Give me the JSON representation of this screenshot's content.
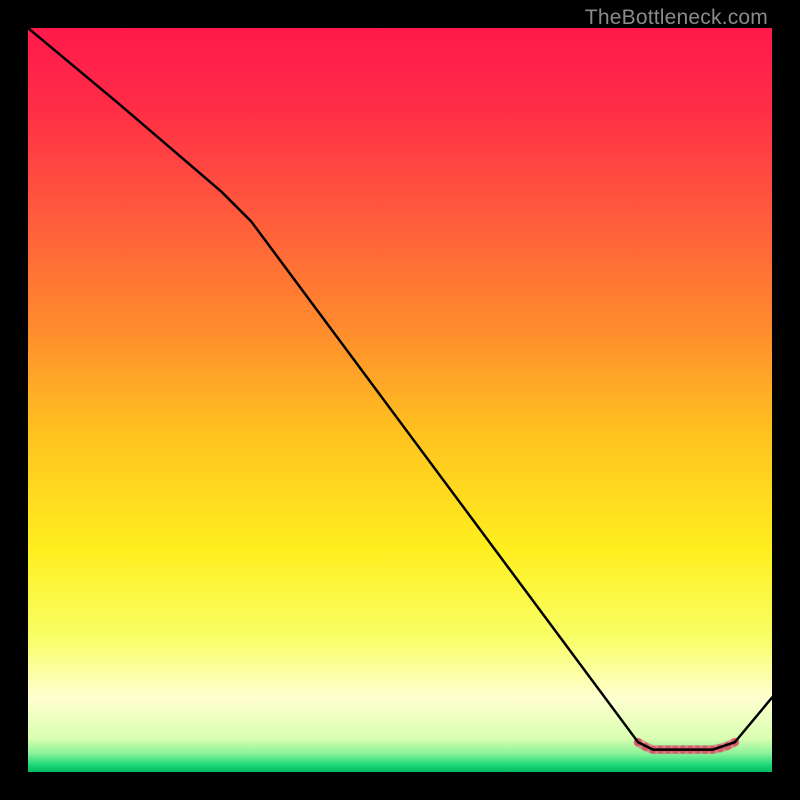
{
  "watermark": "TheBottleneck.com",
  "chart_data": {
    "type": "line",
    "title": "",
    "xlabel": "",
    "ylabel": "",
    "xlim": [
      0,
      100
    ],
    "ylim": [
      0,
      100
    ],
    "grid": false,
    "series": [
      {
        "name": "curve",
        "color": "#000000",
        "x": [
          0,
          12,
          26,
          30,
          82,
          84,
          92,
          95,
          100
        ],
        "y": [
          100,
          90,
          78,
          74,
          4,
          3,
          3,
          4,
          10
        ]
      }
    ],
    "markers": {
      "name": "highlight-segment",
      "color": "#d85a6a",
      "x": [
        82,
        83,
        84,
        85,
        86,
        87,
        88,
        89,
        90,
        91,
        92,
        93,
        94,
        95
      ],
      "y": [
        4,
        3.4,
        3,
        3,
        3,
        3,
        3,
        3,
        3,
        3,
        3,
        3.2,
        3.5,
        4
      ]
    },
    "background_gradient": {
      "stops": [
        {
          "offset": 0.0,
          "color": "#ff1a4b"
        },
        {
          "offset": 0.1,
          "color": "#ff2b47"
        },
        {
          "offset": 0.25,
          "color": "#ff5a3c"
        },
        {
          "offset": 0.4,
          "color": "#ff8a2e"
        },
        {
          "offset": 0.55,
          "color": "#ffc41f"
        },
        {
          "offset": 0.7,
          "color": "#ffef1f"
        },
        {
          "offset": 0.82,
          "color": "#f8ff66"
        },
        {
          "offset": 0.9,
          "color": "#ffffd0"
        },
        {
          "offset": 0.955,
          "color": "#d9ffb0"
        },
        {
          "offset": 0.975,
          "color": "#8cf29a"
        },
        {
          "offset": 0.99,
          "color": "#1fd97a"
        },
        {
          "offset": 1.0,
          "color": "#05b85f"
        }
      ]
    }
  }
}
